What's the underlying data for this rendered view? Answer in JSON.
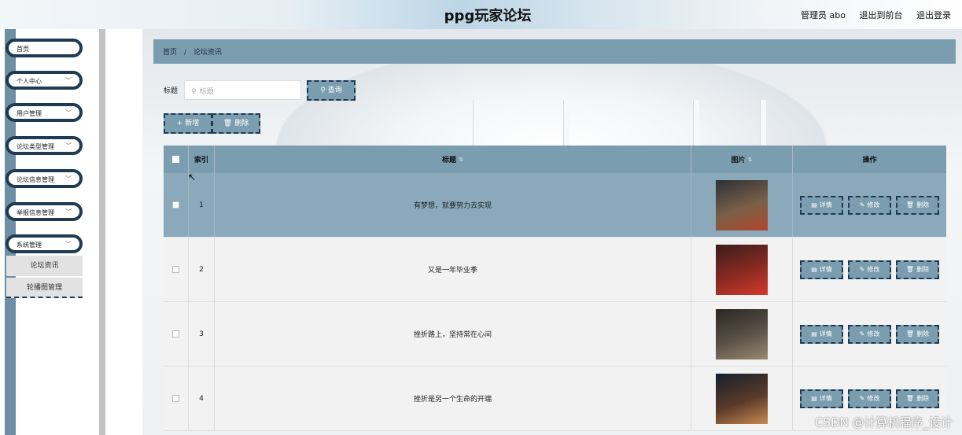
{
  "header": {
    "title": "ppg玩家论坛",
    "admin": "管理员 abo",
    "front": "退出到前台",
    "logout": "退出登录"
  },
  "sidebar": {
    "items": [
      {
        "label": "首页",
        "has_chevron": false
      },
      {
        "label": "个人中心",
        "has_chevron": true
      },
      {
        "label": "用户管理",
        "has_chevron": true
      },
      {
        "label": "论坛类型管理",
        "has_chevron": true
      },
      {
        "label": "论坛信息管理",
        "has_chevron": true
      },
      {
        "label": "举报信息管理",
        "has_chevron": true
      },
      {
        "label": "系统管理",
        "has_chevron": true
      }
    ],
    "sub_items": [
      {
        "label": "论坛资讯"
      },
      {
        "label": "轮播图管理"
      }
    ]
  },
  "breadcrumb": {
    "home": "首页",
    "separator": "/",
    "current": "论坛资讯"
  },
  "search": {
    "label": "标题",
    "placeholder": "标题",
    "button": "查询"
  },
  "toolbar": {
    "add": "新增",
    "delete": "删除"
  },
  "table": {
    "headers": {
      "index": "索引",
      "title": "标题",
      "image": "图片",
      "actions": "操作"
    },
    "rows": [
      {
        "index": "1",
        "title": "有梦想，就要努力去实现",
        "poster_colors": [
          "#2c3138",
          "#7a6048",
          "#b5452c"
        ]
      },
      {
        "index": "2",
        "title": "又是一年毕业季",
        "poster_colors": [
          "#3a1e1a",
          "#8a2a22",
          "#d43a2a"
        ]
      },
      {
        "index": "3",
        "title": "挫折路上，坚持常在心间",
        "poster_colors": [
          "#2a2622",
          "#5c5248",
          "#9a8a72"
        ]
      },
      {
        "index": "4",
        "title": "挫折是另一个生命的开端",
        "poster_colors": [
          "#15202c",
          "#5b3a2a",
          "#c88a50"
        ]
      }
    ],
    "row_actions": {
      "detail": "详情",
      "edit": "修改",
      "delete": "删除"
    }
  },
  "watermark": "CSDN @计算机程序_设计",
  "colors": {
    "accent": "#7b9db0",
    "dark": "#1f3b54",
    "row_highlight": "#8aaabb"
  }
}
